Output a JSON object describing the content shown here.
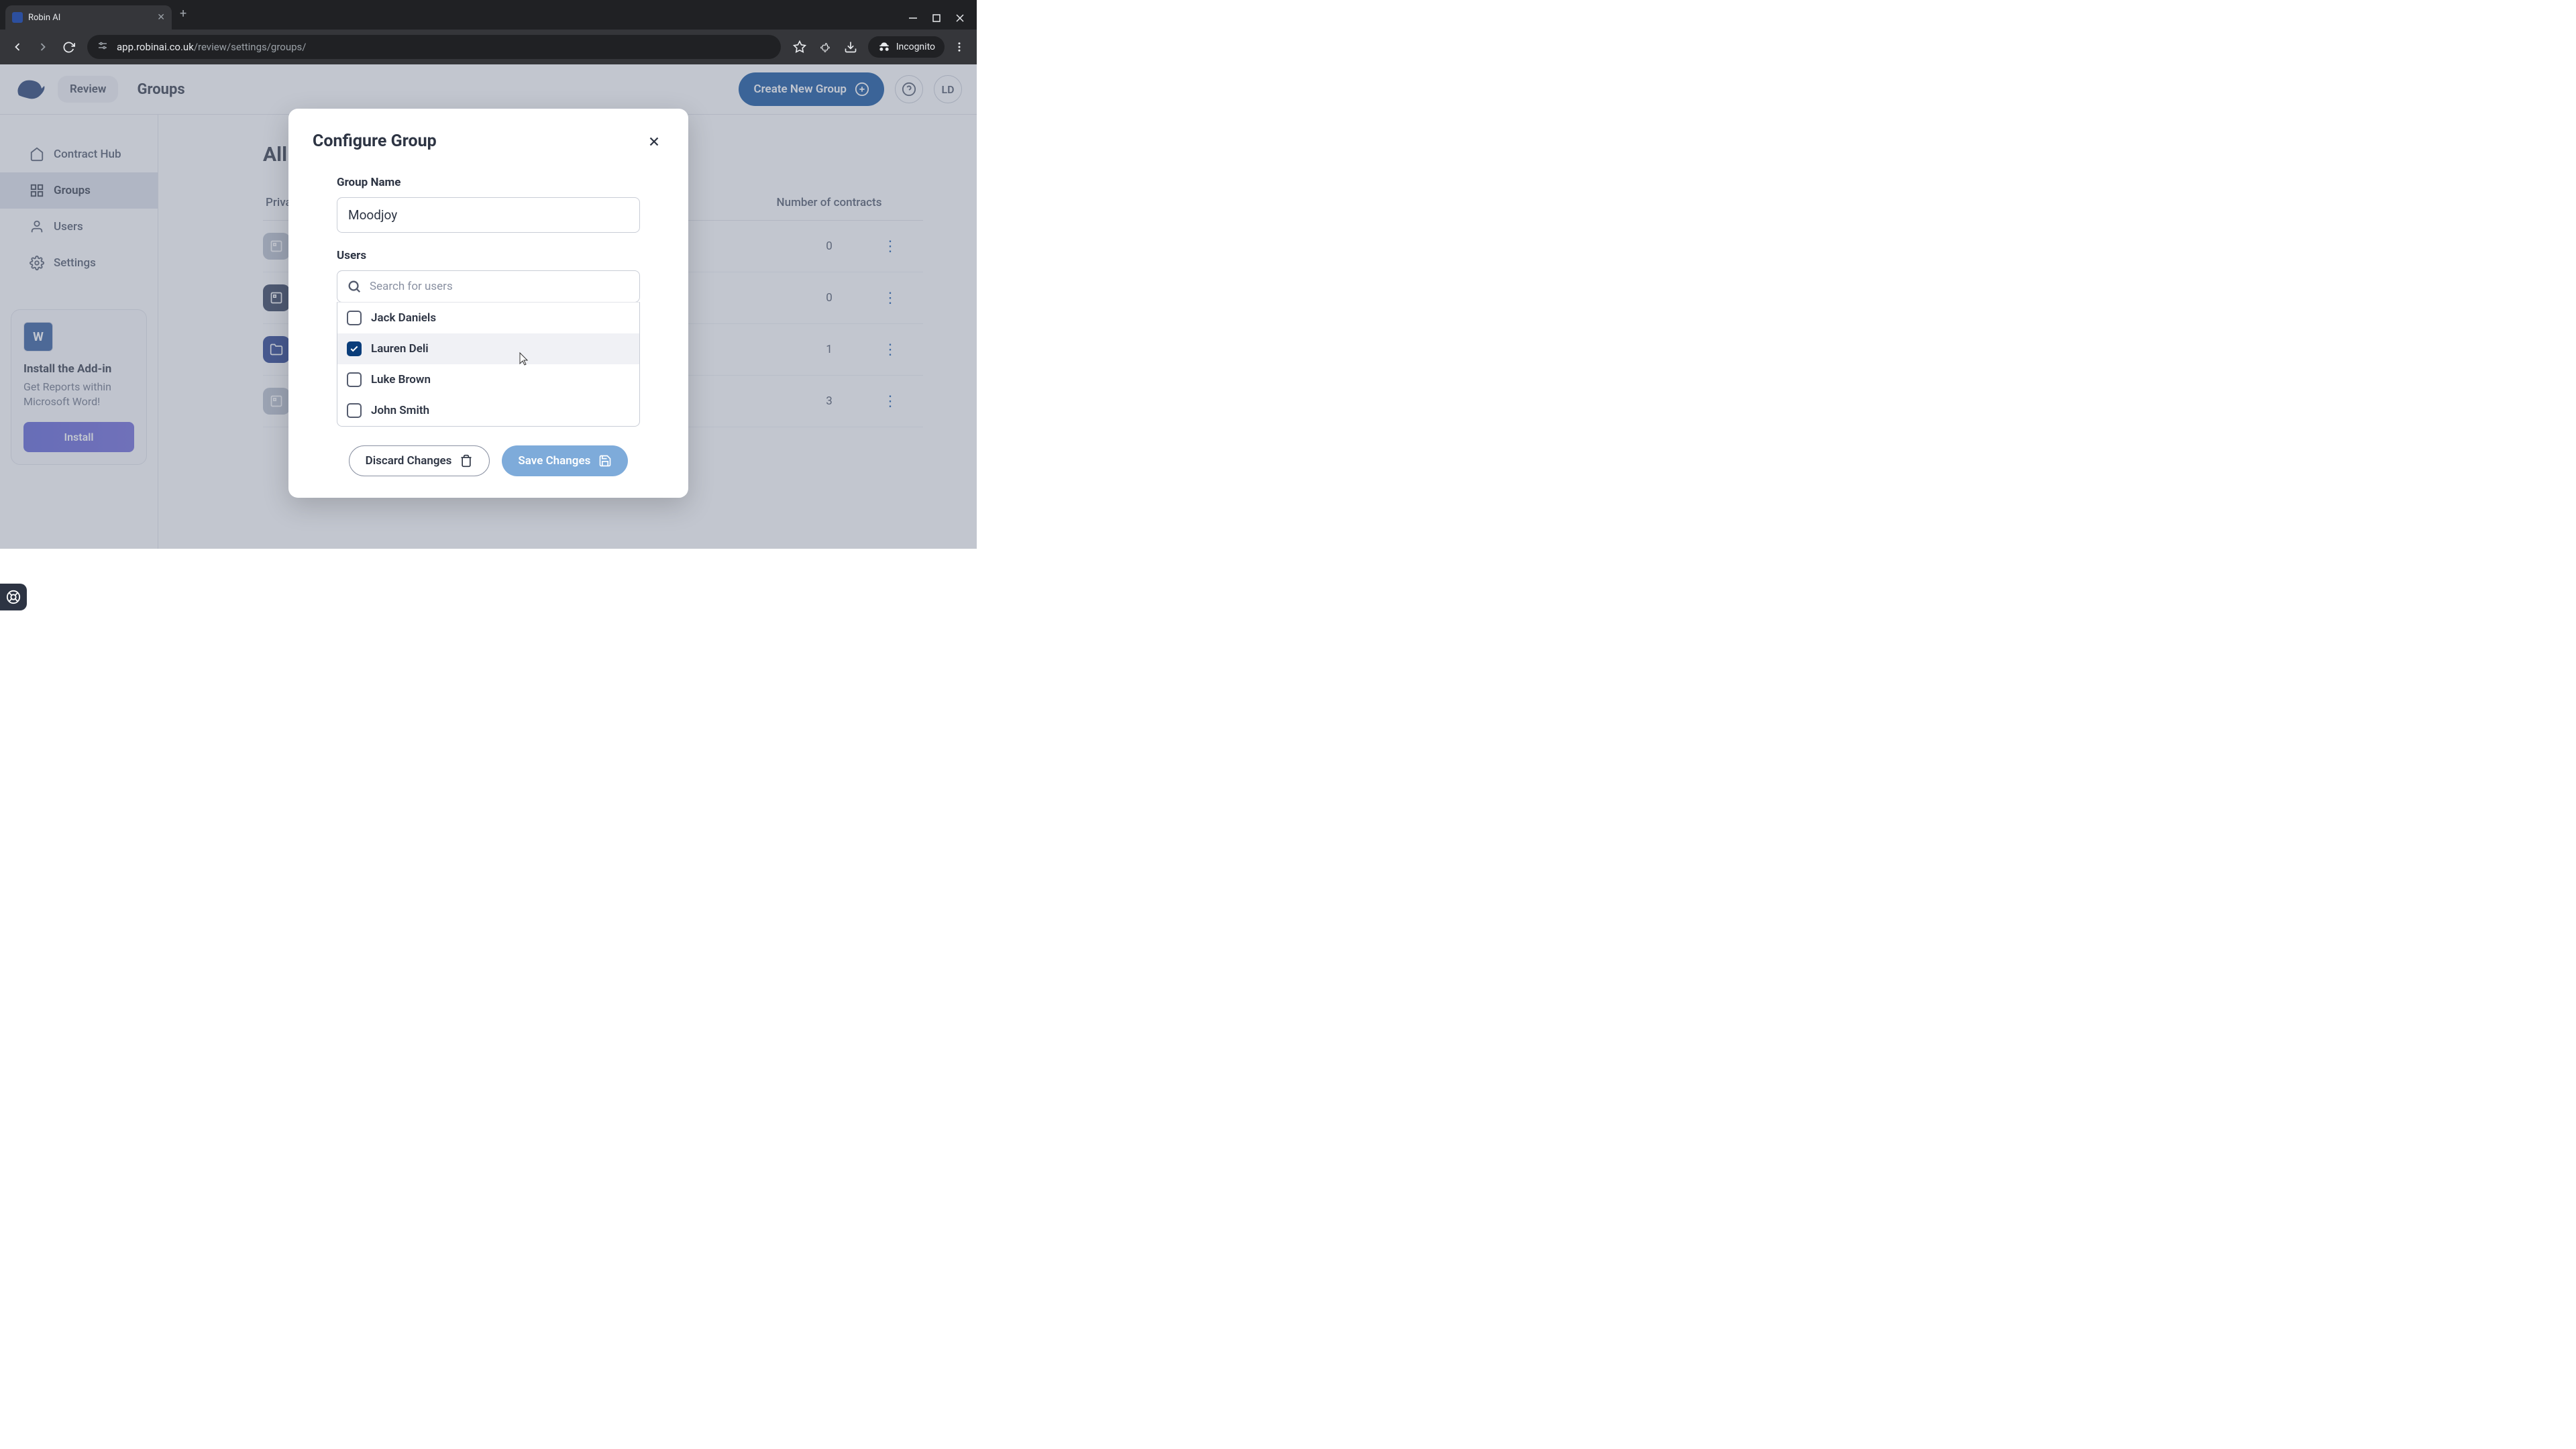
{
  "browser": {
    "tab_title": "Robin AI",
    "url_host": "app.robinai.co.uk",
    "url_path": "/review/settings/groups/",
    "incognito_label": "Incognito"
  },
  "header": {
    "review_label": "Review",
    "title": "Groups",
    "create_btn": "Create New Group",
    "user_initials": "LD"
  },
  "sidebar": {
    "items": [
      {
        "label": "Contract Hub"
      },
      {
        "label": "Groups"
      },
      {
        "label": "Users"
      },
      {
        "label": "Settings"
      }
    ],
    "addin": {
      "title": "Install the Add-in",
      "desc": "Get Reports within Microsoft Word!",
      "install": "Install",
      "word_letter": "W"
    }
  },
  "main": {
    "page_title": "All",
    "col_privacy": "Priva",
    "col_contracts": "Number of contracts",
    "rows": [
      {
        "contracts": "0"
      },
      {
        "contracts": "0"
      },
      {
        "contracts": "1"
      },
      {
        "contracts": "3"
      }
    ]
  },
  "modal": {
    "title": "Configure Group",
    "group_name_label": "Group Name",
    "group_name_value": "Moodjoy",
    "users_label": "Users",
    "search_placeholder": "Search for users",
    "users": [
      {
        "name": "Jack Daniels",
        "checked": false,
        "highlighted": false
      },
      {
        "name": "Lauren Deli",
        "checked": true,
        "highlighted": true
      },
      {
        "name": "Luke Brown",
        "checked": false,
        "highlighted": false
      },
      {
        "name": "John Smith",
        "checked": false,
        "highlighted": false
      }
    ],
    "discard": "Discard Changes",
    "save": "Save Changes"
  }
}
